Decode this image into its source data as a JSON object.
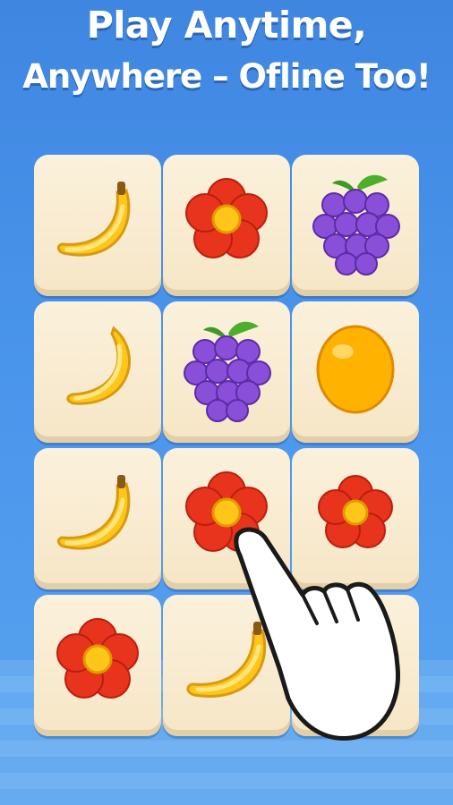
{
  "headline": {
    "line1": "Play Anytime,",
    "line2": "Anywhere – Ofline Too!"
  },
  "colors": {
    "background": "#4a95ec",
    "tile": "#f8ebd2",
    "banana": "#ffc61a",
    "flower": "#e8341c",
    "grapes": "#8a4fd8",
    "orange": "#ffb300"
  },
  "board": {
    "rows": 4,
    "cols": 3,
    "tiles": [
      [
        "banana",
        "flower",
        "grapes"
      ],
      [
        "banana-crescent",
        "grapes",
        "orange"
      ],
      [
        "banana",
        "flower",
        "flower"
      ],
      [
        "flower",
        "banana",
        "covered"
      ]
    ]
  },
  "pointer": "pointing-hand-icon"
}
